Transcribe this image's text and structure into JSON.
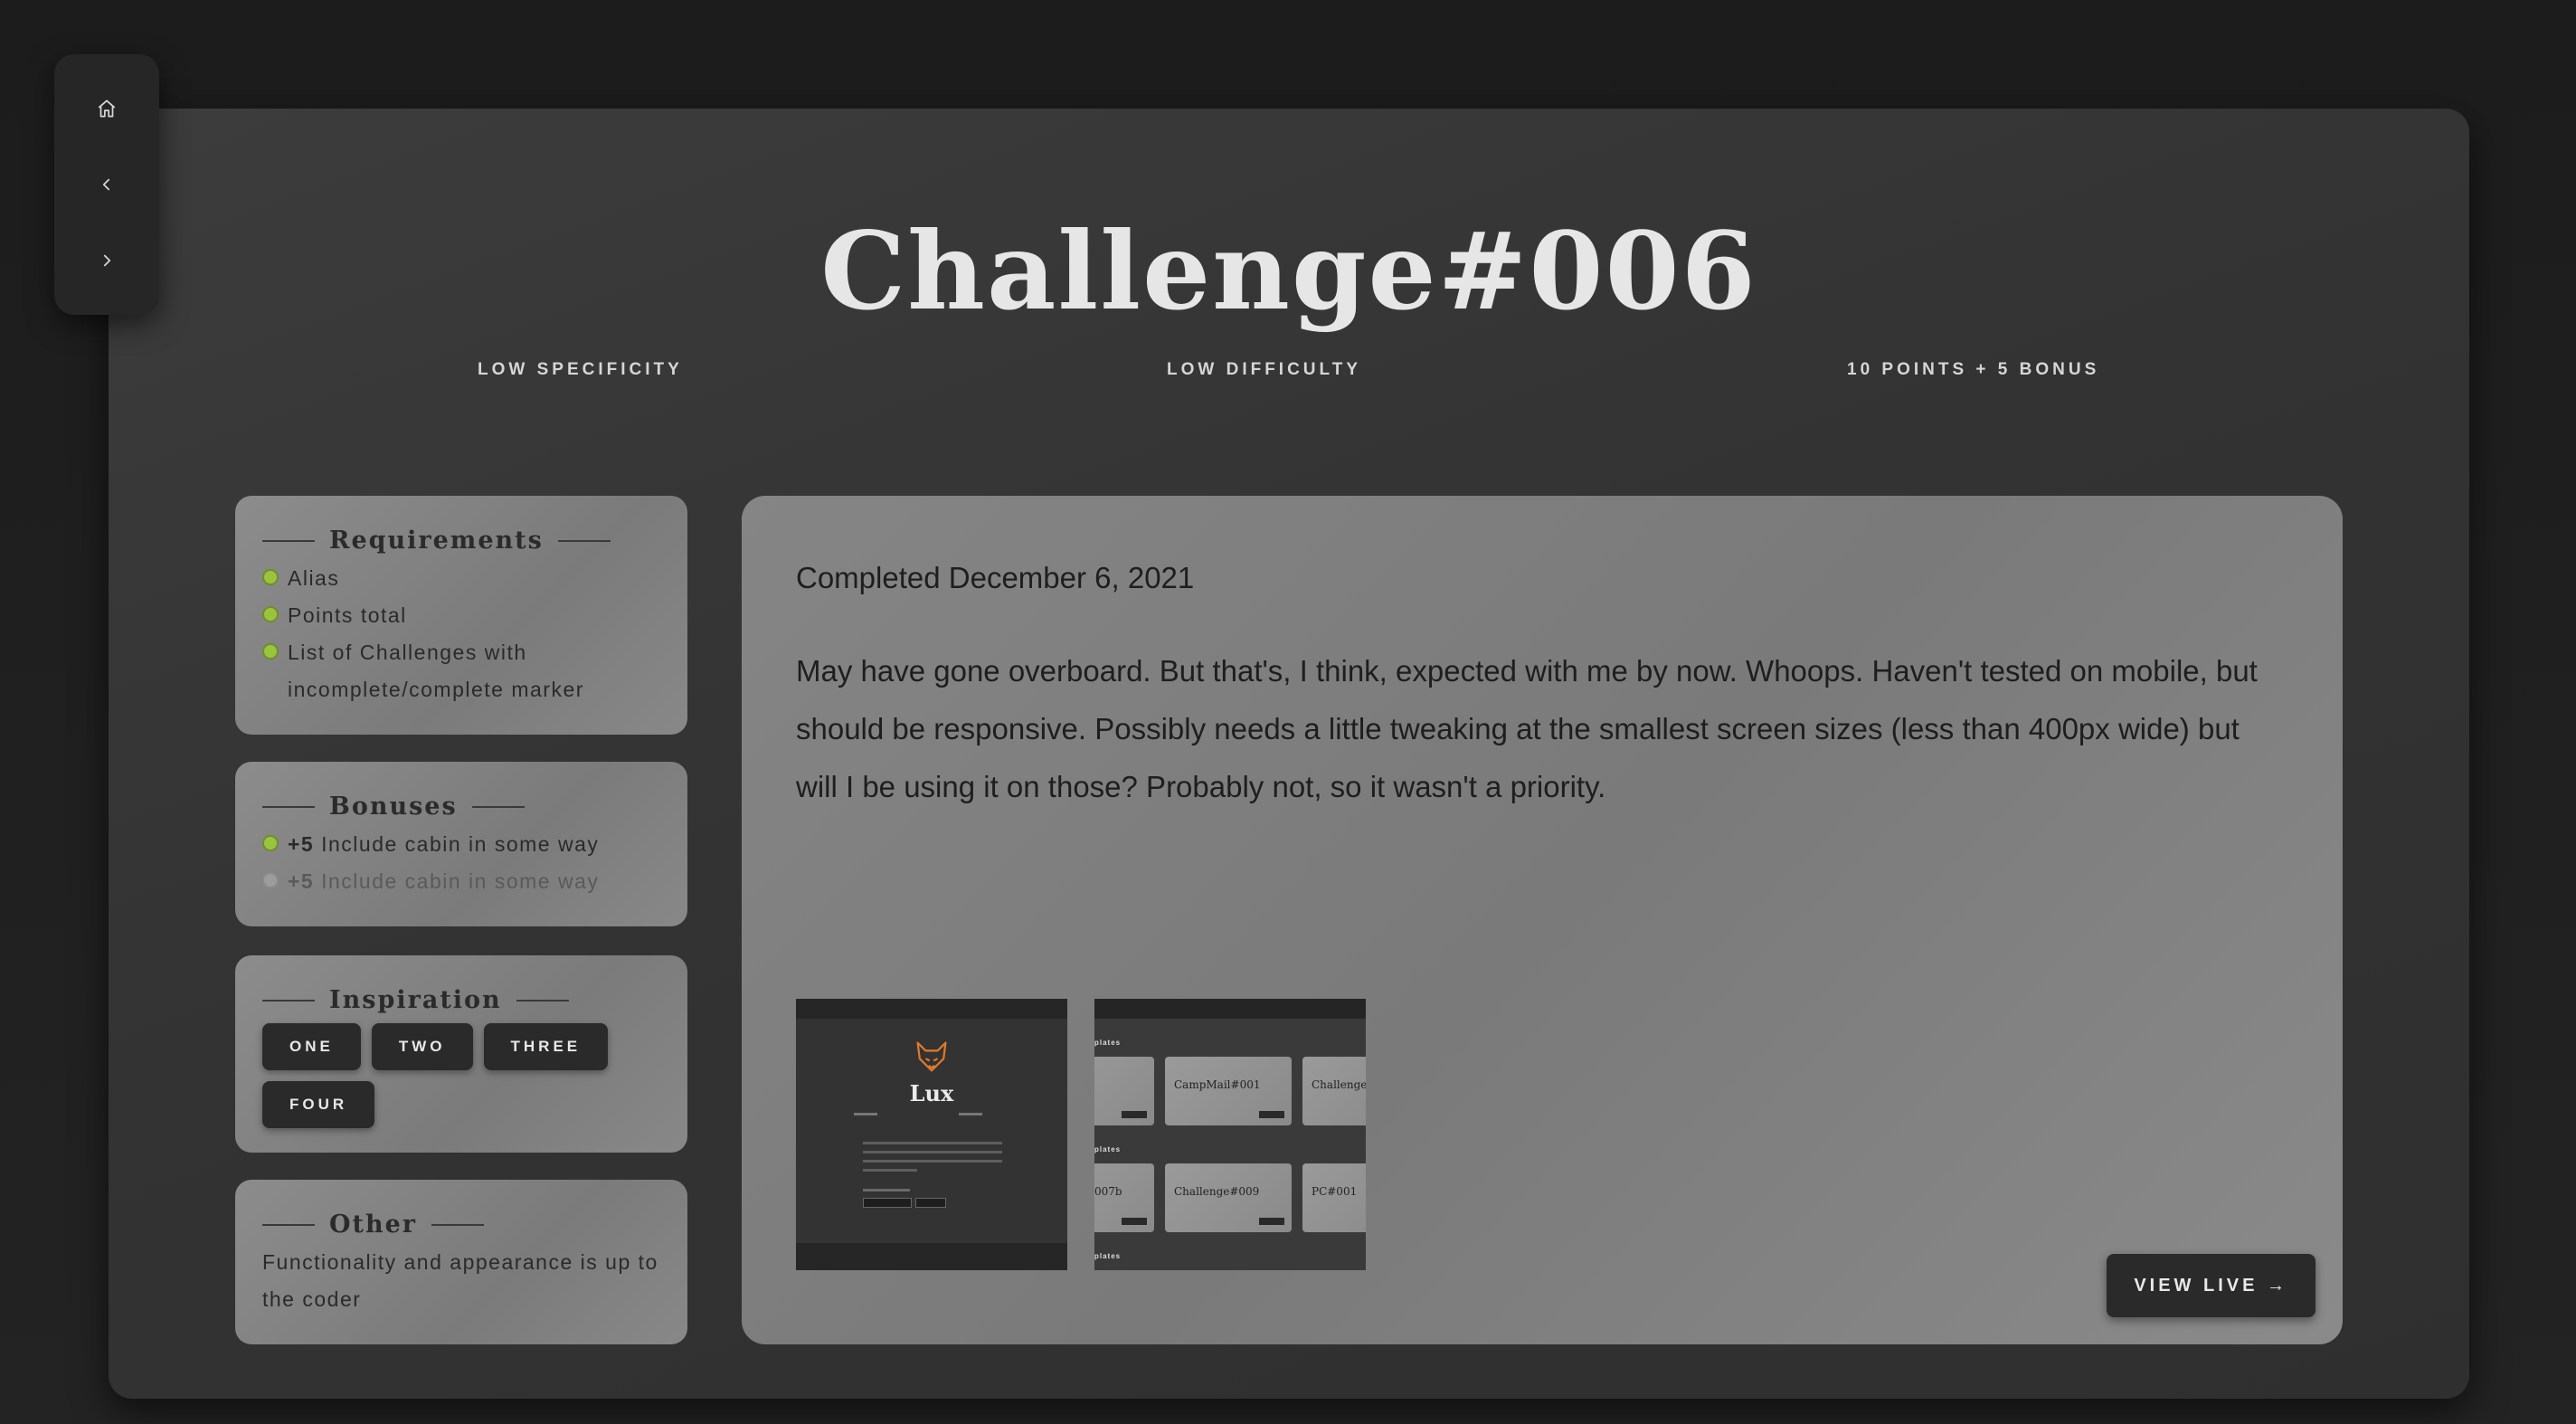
{
  "nav": {
    "home_icon": "home-icon",
    "prev_icon": "chevron-left-icon",
    "next_icon": "chevron-right-icon"
  },
  "header": {
    "title": "Challenge#006",
    "specificity": "LOW SPECIFICITY",
    "difficulty": "LOW DIFFICULTY",
    "points": "10 POINTS + 5 BONUS"
  },
  "requirements": {
    "heading": "Requirements",
    "items": [
      {
        "label": "Alias",
        "done": true
      },
      {
        "label": "Points total",
        "done": true
      },
      {
        "label": "List of Challenges with incomplete/complete marker",
        "done": true
      }
    ]
  },
  "bonuses": {
    "heading": "Bonuses",
    "items": [
      {
        "points": "+5",
        "label": "Include cabin in some way",
        "done": true
      },
      {
        "points": "+5",
        "label": "Include cabin in some way",
        "done": false
      }
    ]
  },
  "inspiration": {
    "heading": "Inspiration",
    "buttons": [
      "ONE",
      "TWO",
      "THREE",
      "FOUR"
    ]
  },
  "other": {
    "heading": "Other",
    "text": "Functionality and appearance is up to the coder"
  },
  "content": {
    "completed": "Completed December 6, 2021",
    "description": "May have gone overboard. But that's, I think, expected with me by now. Whoops. Haven't tested on mobile, but should be responsive. Possibly needs a little tweaking at the smallest screen sizes (less than 400px wide) but will I be using it on those? Probably not, so it wasn't a priority.",
    "view_live": "VIEW LIVE →"
  },
  "thumbnails": {
    "first": {
      "title": "Lux"
    },
    "second": {
      "section_labels": [
        "plates",
        "plates",
        "plates"
      ],
      "cards": [
        "",
        "CampMail#001",
        "Challenge",
        "007b",
        "Challenge#009",
        "PC#001"
      ]
    }
  },
  "colors": {
    "check_on": "#9ac43e",
    "check_off": "#9c9c9c",
    "fox_orange": "#e07a2c"
  }
}
